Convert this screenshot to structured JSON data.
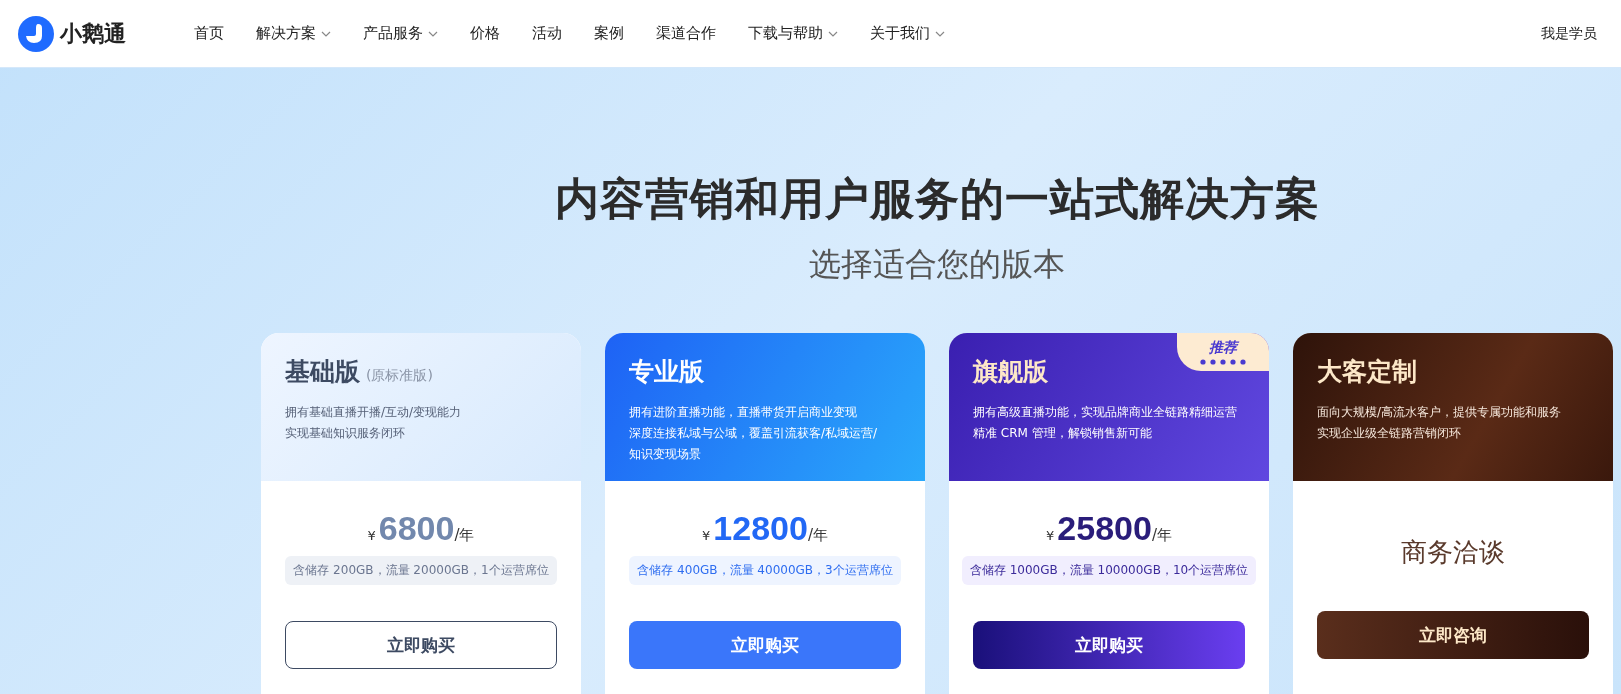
{
  "nav": {
    "brand": "小鹅通",
    "items": [
      {
        "label": "首页",
        "dropdown": false
      },
      {
        "label": "解决方案",
        "dropdown": true
      },
      {
        "label": "产品服务",
        "dropdown": true
      },
      {
        "label": "价格",
        "dropdown": false
      },
      {
        "label": "活动",
        "dropdown": false
      },
      {
        "label": "案例",
        "dropdown": false
      },
      {
        "label": "渠道合作",
        "dropdown": false
      },
      {
        "label": "下载与帮助",
        "dropdown": true
      },
      {
        "label": "关于我们",
        "dropdown": true
      }
    ],
    "student_link": "我是学员"
  },
  "hero": {
    "title": "内容营销和用户服务的一站式解决方案",
    "subtitle": "选择适合您的版本"
  },
  "plans": [
    {
      "kind": "basic",
      "name": "基础版",
      "name_note": "(原标准版)",
      "description": [
        "拥有基础直播开播/互动/变现能力",
        "实现基础知识服务闭环"
      ],
      "currency": "¥",
      "price": "6800",
      "period": "/年",
      "quota": "含储存 200GB，流量 20000GB，1个运营席位",
      "button": "立即购买"
    },
    {
      "kind": "pro",
      "name": "专业版",
      "description": [
        "拥有进阶直播功能，直播带货开启商业变现",
        "深度连接私域与公域，覆盖引流获客/私域运营/",
        "知识变现场景"
      ],
      "currency": "¥",
      "price": "12800",
      "period": "/年",
      "quota": "含储存 400GB，流量 40000GB，3个运营席位",
      "button": "立即购买"
    },
    {
      "kind": "flagship",
      "name": "旗舰版",
      "badge": "推荐",
      "description": [
        "拥有高级直播功能，实现品牌商业全链路精细运营",
        "精准 CRM 管理，解锁销售新可能"
      ],
      "currency": "¥",
      "price": "25800",
      "period": "/年",
      "quota": "含储存 1000GB，流量 100000GB，10个运营席位",
      "button": "立即购买"
    },
    {
      "kind": "enterprise",
      "name": "大客定制",
      "description": [
        "面向大规模/高流水客户，提供专属功能和服务",
        "实现企业级全链路营销闭环"
      ],
      "negotiation": "商务洽谈",
      "button": "立即咨询"
    }
  ]
}
